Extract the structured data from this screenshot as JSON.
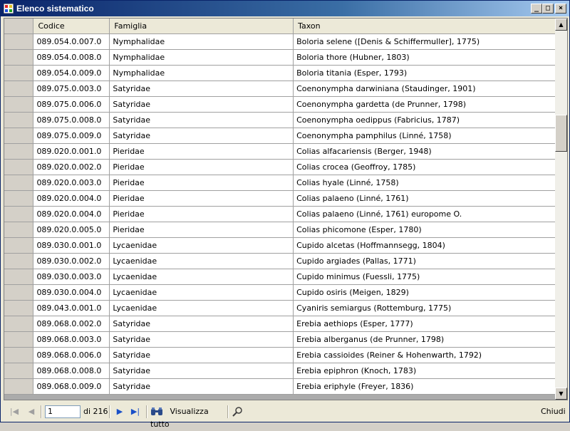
{
  "window": {
    "title": "Elenco sistematico",
    "minimize_symbol": "_",
    "maximize_symbol": "□",
    "close_symbol": "×"
  },
  "grid": {
    "columns": [
      "Codice",
      "Famiglia",
      "Taxon"
    ],
    "rows": [
      [
        "089.054.0.007.0",
        "Nymphalidae",
        "Boloria selene ([Denis & Schiffermuller], 1775)"
      ],
      [
        "089.054.0.008.0",
        "Nymphalidae",
        "Boloria thore (Hubner, 1803)"
      ],
      [
        "089.054.0.009.0",
        "Nymphalidae",
        "Boloria titania (Esper, 1793)"
      ],
      [
        "089.075.0.003.0",
        "Satyridae",
        "Coenonympha darwiniana (Staudinger, 1901)"
      ],
      [
        "089.075.0.006.0",
        "Satyridae",
        "Coenonympha gardetta (de Prunner, 1798)"
      ],
      [
        "089.075.0.008.0",
        "Satyridae",
        "Coenonympha oedippus (Fabricius, 1787)"
      ],
      [
        "089.075.0.009.0",
        "Satyridae",
        "Coenonympha pamphilus (Linné, 1758)"
      ],
      [
        "089.020.0.001.0",
        "Pieridae",
        "Colias alfacariensis (Berger, 1948)"
      ],
      [
        "089.020.0.002.0",
        "Pieridae",
        "Colias crocea (Geoffroy, 1785)"
      ],
      [
        "089.020.0.003.0",
        "Pieridae",
        "Colias hyale (Linné, 1758)"
      ],
      [
        "089.020.0.004.0",
        "Pieridae",
        "Colias palaeno (Linné, 1761)"
      ],
      [
        "089.020.0.004.0",
        "Pieridae",
        "Colias palaeno (Linné, 1761) europome O."
      ],
      [
        "089.020.0.005.0",
        "Pieridae",
        "Colias phicomone (Esper, 1780)"
      ],
      [
        "089.030.0.001.0",
        "Lycaenidae",
        "Cupido alcetas (Hoffmannsegg, 1804)"
      ],
      [
        "089.030.0.002.0",
        "Lycaenidae",
        "Cupido argiades (Pallas, 1771)"
      ],
      [
        "089.030.0.003.0",
        "Lycaenidae",
        "Cupido minimus (Fuessli, 1775)"
      ],
      [
        "089.030.0.004.0",
        "Lycaenidae",
        "Cupido osiris (Meigen, 1829)"
      ],
      [
        "089.043.0.001.0",
        "Lycaenidae",
        "Cyaniris semiargus (Rottemburg, 1775)"
      ],
      [
        "089.068.0.002.0",
        "Satyridae",
        "Erebia aethiops (Esper, 1777)"
      ],
      [
        "089.068.0.003.0",
        "Satyridae",
        "Erebia alberganus (de Prunner, 1798)"
      ],
      [
        "089.068.0.006.0",
        "Satyridae",
        "Erebia cassioides (Reiner & Hohenwarth, 1792)"
      ],
      [
        "089.068.0.008.0",
        "Satyridae",
        "Erebia epiphron (Knoch, 1783)"
      ],
      [
        "089.068.0.009.0",
        "Satyridae",
        "Erebia eriphyle (Freyer, 1836)"
      ]
    ]
  },
  "toolbar": {
    "first_icon": "first-page-icon",
    "prev_icon": "previous-page-icon",
    "page_value": "1",
    "page_count_label": "di 216",
    "next_icon": "next-page-icon",
    "last_icon": "last-page-icon",
    "view_all_icon": "binoculars-icon",
    "view_all_label": "Visualizza tutto",
    "filter_icon": "filter-icon",
    "close_label": "Chiudi"
  }
}
